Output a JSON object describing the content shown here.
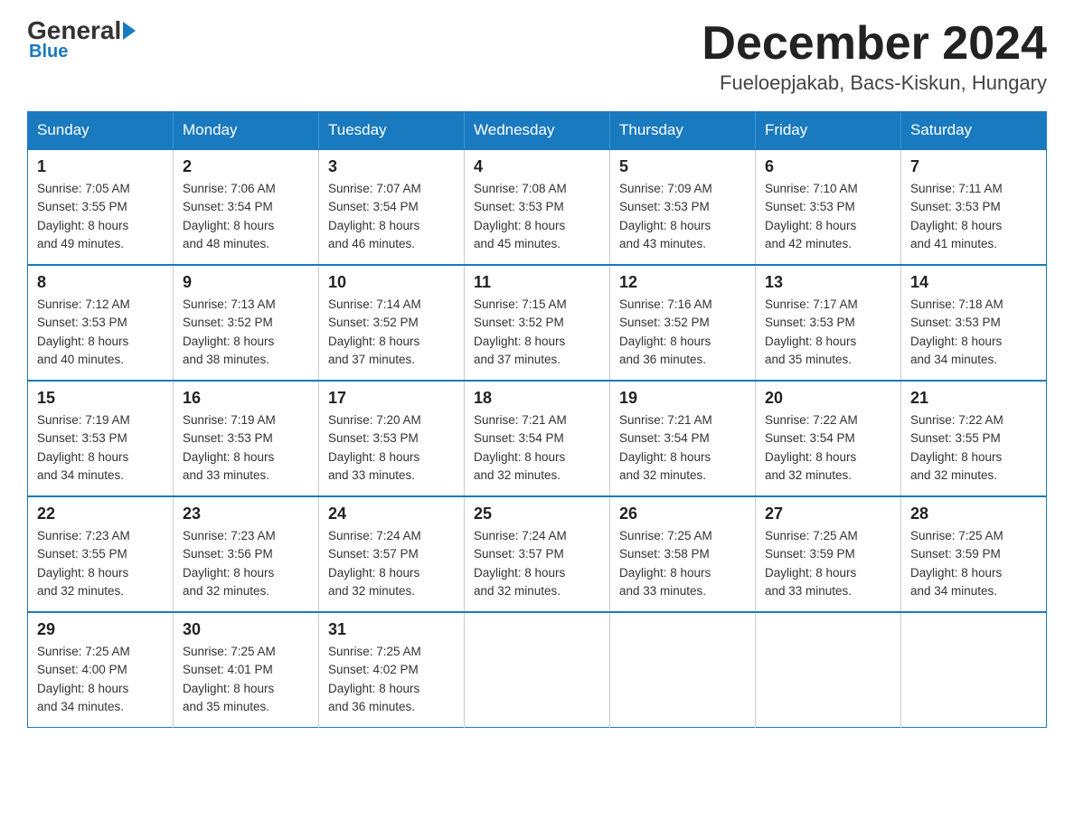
{
  "header": {
    "logo_general": "General",
    "logo_blue": "Blue",
    "month_title": "December 2024",
    "location": "Fueloepjakab, Bacs-Kiskun, Hungary"
  },
  "weekdays": [
    "Sunday",
    "Monday",
    "Tuesday",
    "Wednesday",
    "Thursday",
    "Friday",
    "Saturday"
  ],
  "weeks": [
    [
      {
        "day": "1",
        "sunrise": "7:05 AM",
        "sunset": "3:55 PM",
        "daylight": "8 hours and 49 minutes."
      },
      {
        "day": "2",
        "sunrise": "7:06 AM",
        "sunset": "3:54 PM",
        "daylight": "8 hours and 48 minutes."
      },
      {
        "day": "3",
        "sunrise": "7:07 AM",
        "sunset": "3:54 PM",
        "daylight": "8 hours and 46 minutes."
      },
      {
        "day": "4",
        "sunrise": "7:08 AM",
        "sunset": "3:53 PM",
        "daylight": "8 hours and 45 minutes."
      },
      {
        "day": "5",
        "sunrise": "7:09 AM",
        "sunset": "3:53 PM",
        "daylight": "8 hours and 43 minutes."
      },
      {
        "day": "6",
        "sunrise": "7:10 AM",
        "sunset": "3:53 PM",
        "daylight": "8 hours and 42 minutes."
      },
      {
        "day": "7",
        "sunrise": "7:11 AM",
        "sunset": "3:53 PM",
        "daylight": "8 hours and 41 minutes."
      }
    ],
    [
      {
        "day": "8",
        "sunrise": "7:12 AM",
        "sunset": "3:53 PM",
        "daylight": "8 hours and 40 minutes."
      },
      {
        "day": "9",
        "sunrise": "7:13 AM",
        "sunset": "3:52 PM",
        "daylight": "8 hours and 38 minutes."
      },
      {
        "day": "10",
        "sunrise": "7:14 AM",
        "sunset": "3:52 PM",
        "daylight": "8 hours and 37 minutes."
      },
      {
        "day": "11",
        "sunrise": "7:15 AM",
        "sunset": "3:52 PM",
        "daylight": "8 hours and 37 minutes."
      },
      {
        "day": "12",
        "sunrise": "7:16 AM",
        "sunset": "3:52 PM",
        "daylight": "8 hours and 36 minutes."
      },
      {
        "day": "13",
        "sunrise": "7:17 AM",
        "sunset": "3:53 PM",
        "daylight": "8 hours and 35 minutes."
      },
      {
        "day": "14",
        "sunrise": "7:18 AM",
        "sunset": "3:53 PM",
        "daylight": "8 hours and 34 minutes."
      }
    ],
    [
      {
        "day": "15",
        "sunrise": "7:19 AM",
        "sunset": "3:53 PM",
        "daylight": "8 hours and 34 minutes."
      },
      {
        "day": "16",
        "sunrise": "7:19 AM",
        "sunset": "3:53 PM",
        "daylight": "8 hours and 33 minutes."
      },
      {
        "day": "17",
        "sunrise": "7:20 AM",
        "sunset": "3:53 PM",
        "daylight": "8 hours and 33 minutes."
      },
      {
        "day": "18",
        "sunrise": "7:21 AM",
        "sunset": "3:54 PM",
        "daylight": "8 hours and 32 minutes."
      },
      {
        "day": "19",
        "sunrise": "7:21 AM",
        "sunset": "3:54 PM",
        "daylight": "8 hours and 32 minutes."
      },
      {
        "day": "20",
        "sunrise": "7:22 AM",
        "sunset": "3:54 PM",
        "daylight": "8 hours and 32 minutes."
      },
      {
        "day": "21",
        "sunrise": "7:22 AM",
        "sunset": "3:55 PM",
        "daylight": "8 hours and 32 minutes."
      }
    ],
    [
      {
        "day": "22",
        "sunrise": "7:23 AM",
        "sunset": "3:55 PM",
        "daylight": "8 hours and 32 minutes."
      },
      {
        "day": "23",
        "sunrise": "7:23 AM",
        "sunset": "3:56 PM",
        "daylight": "8 hours and 32 minutes."
      },
      {
        "day": "24",
        "sunrise": "7:24 AM",
        "sunset": "3:57 PM",
        "daylight": "8 hours and 32 minutes."
      },
      {
        "day": "25",
        "sunrise": "7:24 AM",
        "sunset": "3:57 PM",
        "daylight": "8 hours and 32 minutes."
      },
      {
        "day": "26",
        "sunrise": "7:25 AM",
        "sunset": "3:58 PM",
        "daylight": "8 hours and 33 minutes."
      },
      {
        "day": "27",
        "sunrise": "7:25 AM",
        "sunset": "3:59 PM",
        "daylight": "8 hours and 33 minutes."
      },
      {
        "day": "28",
        "sunrise": "7:25 AM",
        "sunset": "3:59 PM",
        "daylight": "8 hours and 34 minutes."
      }
    ],
    [
      {
        "day": "29",
        "sunrise": "7:25 AM",
        "sunset": "4:00 PM",
        "daylight": "8 hours and 34 minutes."
      },
      {
        "day": "30",
        "sunrise": "7:25 AM",
        "sunset": "4:01 PM",
        "daylight": "8 hours and 35 minutes."
      },
      {
        "day": "31",
        "sunrise": "7:25 AM",
        "sunset": "4:02 PM",
        "daylight": "8 hours and 36 minutes."
      },
      null,
      null,
      null,
      null
    ]
  ],
  "labels": {
    "sunrise": "Sunrise:",
    "sunset": "Sunset:",
    "daylight": "Daylight:"
  }
}
